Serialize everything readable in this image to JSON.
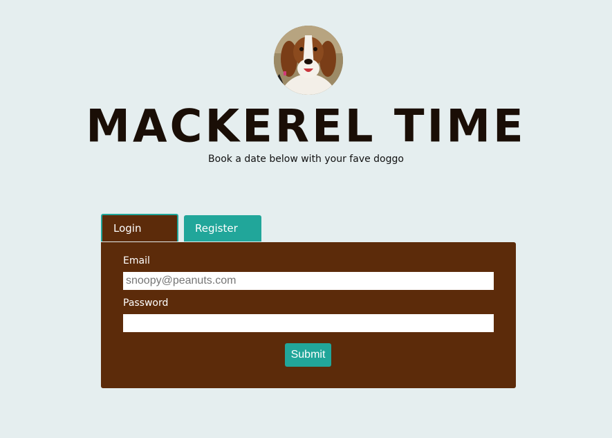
{
  "header": {
    "avatar_alt": "beagle dog photo",
    "title": "MACKEREL TIME",
    "tagline": "Book a date below with your fave doggo"
  },
  "tabs": [
    {
      "label": "Login",
      "active": true
    },
    {
      "label": "Register",
      "active": false
    }
  ],
  "login_form": {
    "email_label": "Email",
    "email_placeholder": "snoopy@peanuts.com",
    "email_value": "",
    "password_label": "Password",
    "password_value": "",
    "submit_label": "Submit"
  },
  "colors": {
    "background": "#e5eeef",
    "panel": "#5c2b0a",
    "accent": "#21a69a",
    "title": "#1a0e06"
  }
}
